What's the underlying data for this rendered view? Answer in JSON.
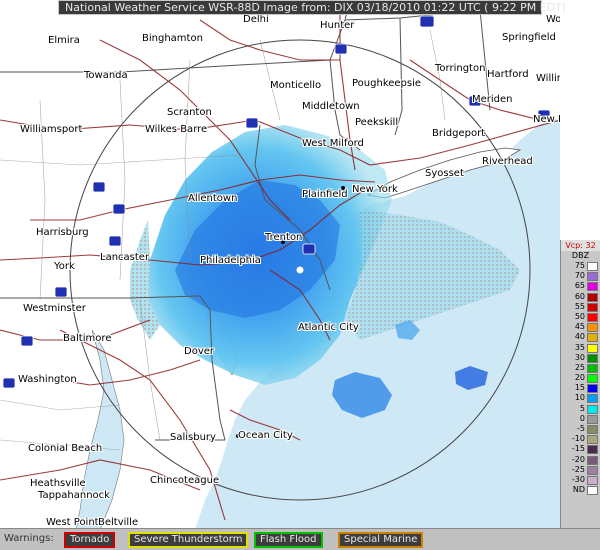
{
  "title": "National Weather Service WSR-88D Image from: DIX 03/18/2010 01:22 UTC ( 9:22 PM EDT)",
  "legend": {
    "vcp": "Vcp: 32",
    "unit": "DBZ",
    "entries": [
      {
        "label": "75",
        "color": "#ffffff"
      },
      {
        "label": "70",
        "color": "#9a6ad9"
      },
      {
        "label": "65",
        "color": "#e000e0"
      },
      {
        "label": "60",
        "color": "#b00000"
      },
      {
        "label": "55",
        "color": "#d00000"
      },
      {
        "label": "50",
        "color": "#ff0000"
      },
      {
        "label": "45",
        "color": "#ff9000"
      },
      {
        "label": "40",
        "color": "#e0b000"
      },
      {
        "label": "35",
        "color": "#ffff00"
      },
      {
        "label": "30",
        "color": "#008f00"
      },
      {
        "label": "25",
        "color": "#00c000"
      },
      {
        "label": "20",
        "color": "#00ff00"
      },
      {
        "label": "15",
        "color": "#0000f6"
      },
      {
        "label": "10",
        "color": "#01a0f6"
      },
      {
        "label": "5",
        "color": "#00eced"
      },
      {
        "label": "0",
        "color": "#9a9a9a"
      },
      {
        "label": "-5",
        "color": "#8a8a6a"
      },
      {
        "label": "-10",
        "color": "#a8a880"
      },
      {
        "label": "-15",
        "color": "#4a2a4a"
      },
      {
        "label": "-20",
        "color": "#7a5a7a"
      },
      {
        "label": "-25",
        "color": "#a080a0"
      },
      {
        "label": "-30",
        "color": "#c8b0c8"
      },
      {
        "label": "ND",
        "color": "#ffffff"
      }
    ]
  },
  "warnings": {
    "label": "Warnings:",
    "tornado": "Tornado",
    "severe": "Severe Thunderstorm",
    "flood": "Flash Flood",
    "marine": "Special Marine"
  },
  "cities": {
    "delhi": "Delhi",
    "hunter": "Hunter",
    "worcester": "Worcester",
    "elmira": "Elmira",
    "binghamton": "Binghamton",
    "springfield": "Springfield",
    "towanda": "Towanda",
    "monticello": "Monticello",
    "poughkeepsie": "Poughkeepsie",
    "torrington": "Torrington",
    "hartford": "Hartford",
    "willimantic": "Willimantic",
    "meriden": "Meriden",
    "middletown": "Middletown",
    "scranton": "Scranton",
    "williamsport": "Williamsport",
    "wilkesbarre": "Wilkes Barre",
    "peekskill": "Peekskill",
    "newlondon": "New London",
    "bridgeport": "Bridgeport",
    "westmilford": "West Milford",
    "syosset": "Syosset",
    "riverhead": "Riverhead",
    "allentown": "Allentown",
    "plainfield": "Plainfield",
    "newyork": "New York",
    "harrisburg": "Harrisburg",
    "trenton": "Trenton",
    "lancaster": "Lancaster",
    "york": "York",
    "philadelphia": "Philadelphia",
    "westminster": "Westminster",
    "atlanticcity": "Atlantic City",
    "baltimore": "Baltimore",
    "dover": "Dover",
    "washington": "Washington",
    "salisbury": "Salisbury",
    "oceancity": "Ocean City",
    "colonialbeach": "Colonial Beach",
    "chincoteague": "Chincoteague",
    "heathsville": "Heathsville",
    "tappahannock": "Tappahannock",
    "westpoint": "West Point",
    "beltville": "Beltville"
  },
  "colors": {
    "ocean": "#cfe8f5",
    "land": "#ffffff",
    "range_ring": "#444444",
    "interstate_shield": "#2030b0"
  }
}
